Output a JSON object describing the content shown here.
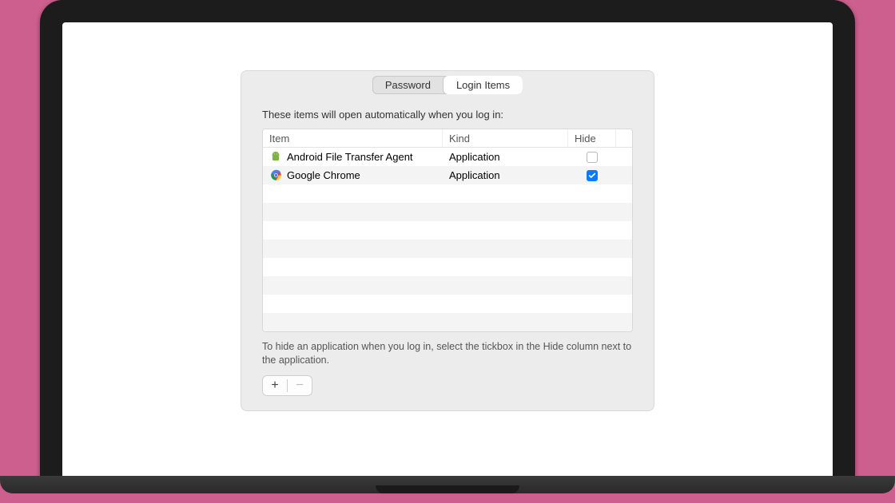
{
  "tabs": {
    "password_label": "Password",
    "login_items_label": "Login Items",
    "active": "login_items"
  },
  "content": {
    "intro": "These items will open automatically when you log in:",
    "columns": {
      "item": "Item",
      "kind": "Kind",
      "hide": "Hide"
    },
    "rows": [
      {
        "icon": "android",
        "name": "Android File Transfer Agent",
        "kind": "Application",
        "hide": false
      },
      {
        "icon": "chrome",
        "name": "Google Chrome",
        "kind": "Application",
        "hide": true
      }
    ],
    "empty_row_count": 8,
    "hint": "To hide an application when you log in, select the tickbox in the Hide column next to the application."
  },
  "controls": {
    "add_label": "+",
    "remove_label": "−",
    "remove_enabled": false
  }
}
